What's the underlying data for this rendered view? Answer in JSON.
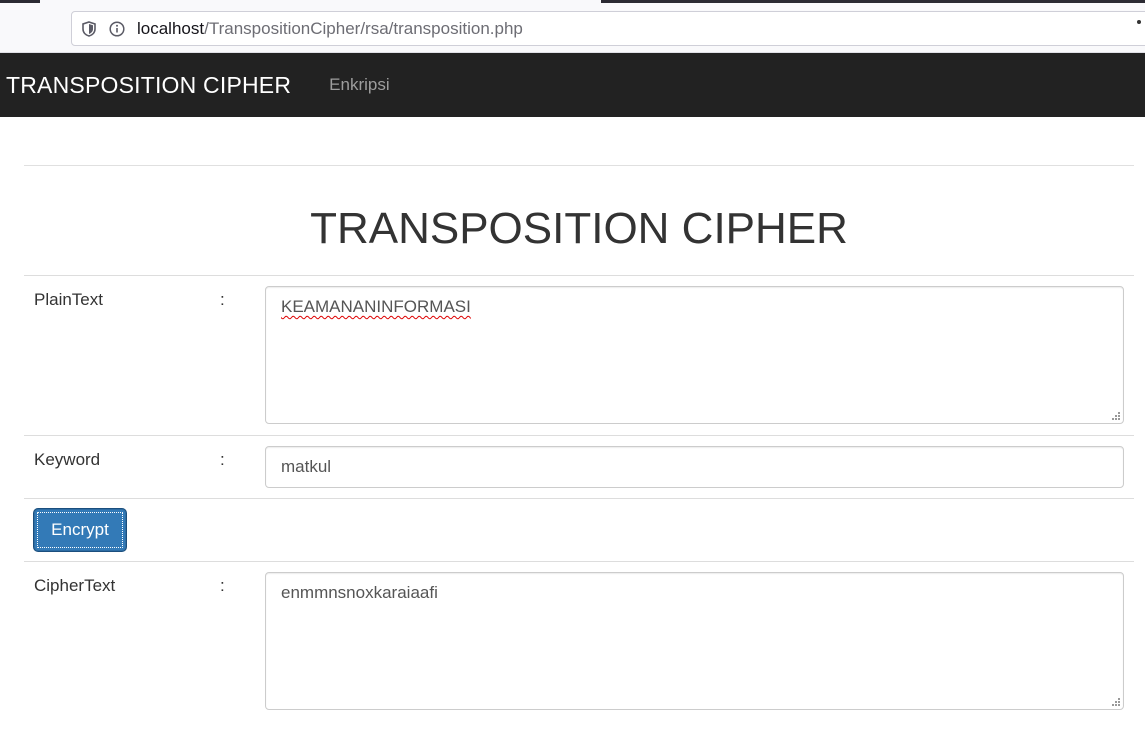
{
  "browser": {
    "url_host": "localhost",
    "url_path": "/TranspositionCipher/rsa/transposition.php"
  },
  "navbar": {
    "brand": "TRANSPOSITION CIPHER",
    "links": [
      {
        "label": "Enkripsi"
      }
    ]
  },
  "main": {
    "title": "TRANSPOSITION CIPHER",
    "plaintext": {
      "label": "PlainText",
      "colon": ":",
      "value": "KEAMANANINFORMASI"
    },
    "keyword": {
      "label": "Keyword",
      "colon": ":",
      "value": "matkul"
    },
    "encrypt_button": {
      "label": "Encrypt"
    },
    "ciphertext": {
      "label": "CipherText",
      "colon": ":",
      "value": "enmmnsnoxkaraiaafi"
    }
  },
  "colors": {
    "navbar_bg": "#222222",
    "primary_button": "#337ab7"
  }
}
